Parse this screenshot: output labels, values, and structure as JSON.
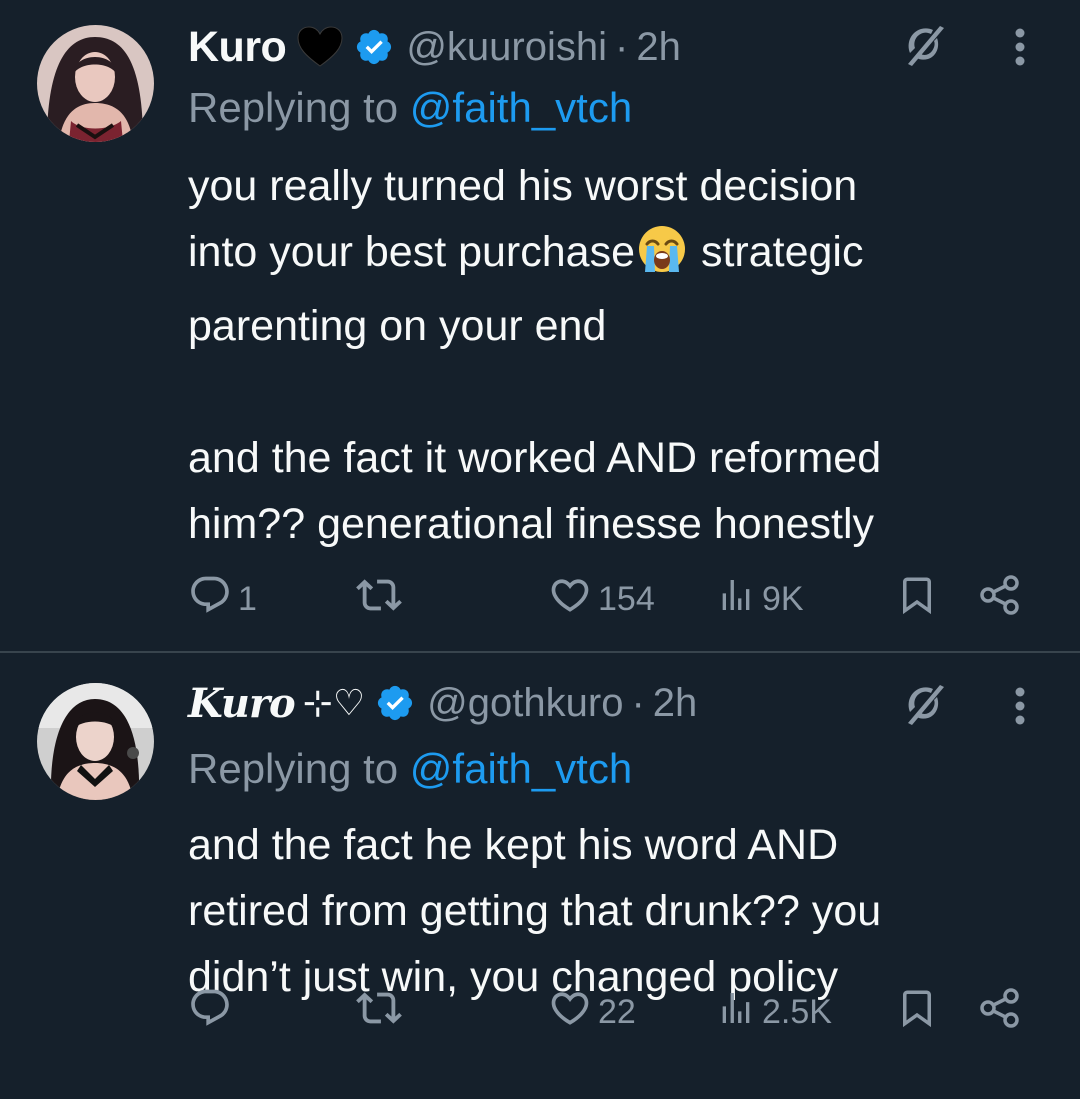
{
  "tweets": [
    {
      "display_name": "Kuro",
      "handle": "@kuuroishi",
      "separator": "·",
      "time": "2h",
      "replying_prefix": "Replying to ",
      "replying_to": "@faith_vtch",
      "text_part1": "you really turned his worst decision\ninto your best purchase",
      "text_part2": " strategic\nparenting on your end\n\nand the fact it worked AND reformed\nhim?? generational finesse honestly",
      "reply_count": "1",
      "retweet_count": "",
      "like_count": "154",
      "view_count": "9K"
    },
    {
      "display_name": "Kuro",
      "name_decoration": "⊹♡",
      "handle": "@gothkuro",
      "separator": "·",
      "time": "2h",
      "replying_prefix": "Replying to ",
      "replying_to": "@faith_vtch",
      "text": "and the fact he kept his word AND\nretired from getting that drunk?? you\ndidn’t just win, you changed policy",
      "reply_count": "",
      "retweet_count": "",
      "like_count": "22",
      "view_count": "2.5K"
    }
  ],
  "colors": {
    "background": "#15202b",
    "text": "#f7f9f9",
    "secondary": "#8b98a5",
    "accent": "#1d9bf0",
    "divider": "#38444d"
  },
  "icons": [
    "avatar",
    "black-heart-icon",
    "verified-badge-icon",
    "grok-icon",
    "more-icon",
    "loudly-crying-emoji",
    "reply-icon",
    "retweet-icon",
    "like-icon",
    "views-icon",
    "bookmark-icon",
    "share-icon"
  ]
}
